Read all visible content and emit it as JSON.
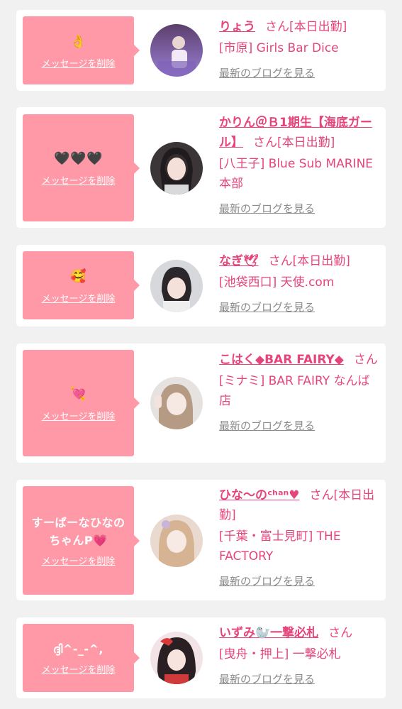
{
  "delete_label": "メッセージを削除",
  "blog_label": "最新のブログを見る",
  "colors": {
    "background": "#f1f1f1",
    "card": "#ffffff",
    "message_bubble": "#ff99a8",
    "name_text": "#e5457a",
    "blog_link": "#8a8a8a"
  },
  "cards": [
    {
      "message": "👌",
      "name": "りょう",
      "san": "さん",
      "status": "[本日出勤]",
      "shop": "[市原] Girls Bar Dice",
      "avatar_icon": "avatar-photo"
    },
    {
      "message": "🖤🖤🖤",
      "name": "かりん＠Ｂ1期生【海底ガール】",
      "san": "さん",
      "status": "[本日出勤]",
      "shop": "[八王子] Blue Sub MARINE 本部",
      "avatar_icon": "avatar-photo"
    },
    {
      "message": "🥰",
      "name": "なぎ🕊",
      "san": "さん",
      "status": "[本日出勤]",
      "shop": "[池袋西口] 天使.com",
      "avatar_icon": "avatar-photo"
    },
    {
      "message": "💘",
      "name": "こはく◆BAR FAIRY◆",
      "san": "さん",
      "status": "",
      "shop": "[ミナミ] BAR FAIRY なんば店",
      "avatar_icon": "avatar-photo"
    },
    {
      "message": "すーぱーなひなのちゃんP💗",
      "name": "ひな〜のᶜʰᵃⁿ♥",
      "san": "さん",
      "status": "[本日出勤]",
      "shop": "[千葉・富士見町] THE FACTORY",
      "avatar_icon": "avatar-photo"
    },
    {
      "message": "ദ്ദി^-_-^,",
      "name": "いずみ🦭一撃必札",
      "san": "さん",
      "status": "",
      "shop": "[曳舟・押上] 一撃必札",
      "avatar_icon": "avatar-photo"
    }
  ]
}
